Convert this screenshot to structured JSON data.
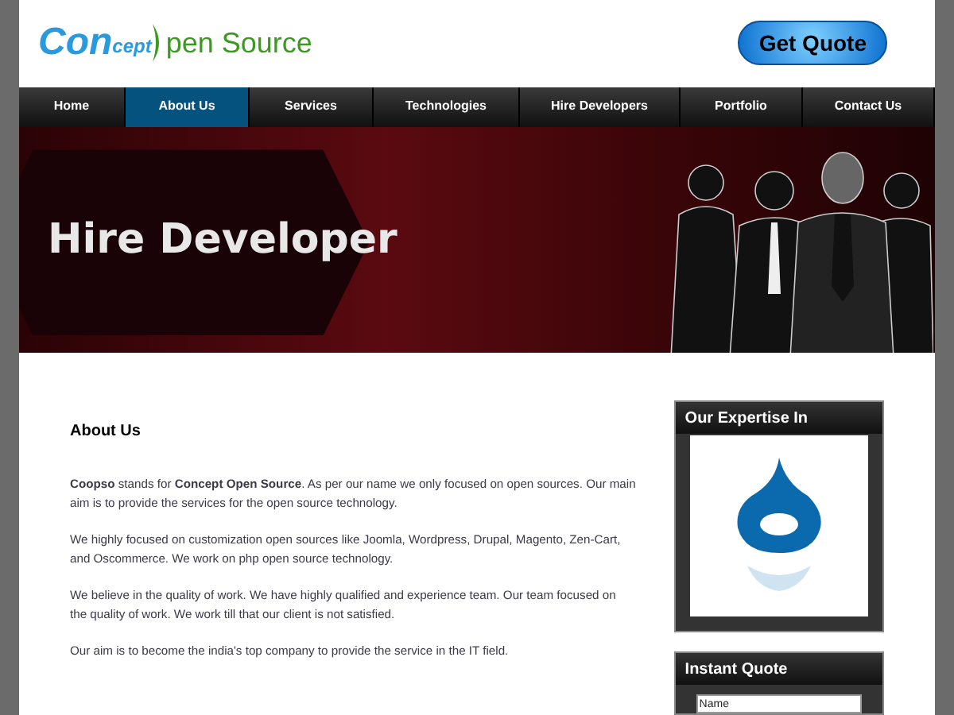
{
  "logo": {
    "part1": "Con",
    "part2": "cept",
    "part3": "pen Source"
  },
  "header_button": "Get Quote",
  "nav": [
    {
      "label": "Home",
      "selected": false
    },
    {
      "label": "About Us",
      "selected": true
    },
    {
      "label": "Services",
      "selected": false
    },
    {
      "label": "Technologies",
      "selected": false
    },
    {
      "label": "Hire Developers",
      "selected": false
    },
    {
      "label": "Portfolio",
      "selected": false
    },
    {
      "label": "Contact Us",
      "selected": false
    }
  ],
  "banner": {
    "title": "Hire Developer"
  },
  "main": {
    "heading": "About Us",
    "paragraphs": [
      "**Coopso** stands for **Concept Open Source**. As per our name we only focused on open sources. Our main aim is to provide the services for the open source technology.",
      "We highly focused on customization open sources like Joomla, Wordpress, Drupal, Magento, Zen-Cart, and Oscommerce. We work on php open source technology.",
      "We believe in the quality of work. We have highly qualified and experience team. Our team focused on the quality of work. We work till that our client is not satisfied.",
      "Our aim is to become the india's top company to provide the service in the IT field."
    ]
  },
  "sidebar": {
    "expertise": {
      "title": "Our Expertise In"
    },
    "quote": {
      "title": "Instant Quote",
      "fields": [
        {
          "placeholder": "Name"
        }
      ]
    }
  }
}
